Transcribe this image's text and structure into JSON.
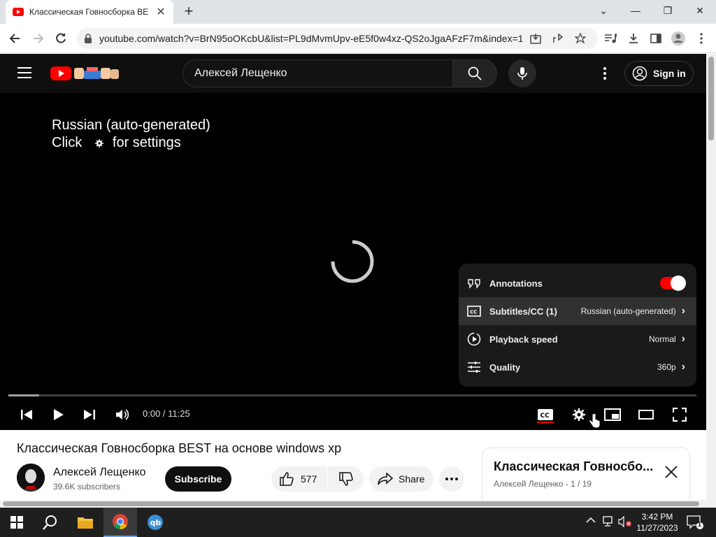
{
  "browser": {
    "tab_title": "Классическая Говносборка BEST",
    "url": "youtube.com/watch?v=BrN95oOKcbU&list=PL9dMvmUpv-eE5f0w4xz-QS2oJgaAFzF7m&index=1"
  },
  "youtube": {
    "search_value": "Алексей Лещенко",
    "sign_in_label": "Sign in"
  },
  "player": {
    "caption_line1": "Russian (auto-generated)",
    "caption_click": "Click",
    "caption_settings": "for settings",
    "time": "0:00 / 11:25",
    "settings_menu": [
      {
        "label": "Annotations",
        "value": "",
        "icon": "annotations-icon"
      },
      {
        "label": "Subtitles/CC (1)",
        "value": "Russian (auto-generated)",
        "icon": "subtitles-icon"
      },
      {
        "label": "Playback speed",
        "value": "Normal",
        "icon": "playback-speed-icon"
      },
      {
        "label": "Quality",
        "value": "360p",
        "icon": "quality-icon"
      }
    ],
    "annotations_on": true
  },
  "video": {
    "title": "Классическая Говносборка BEST на основе windows xp",
    "channel": "Алексей Лещенко",
    "subscribers": "39.6K subscribers",
    "subscribe_label": "Subscribe",
    "likes": "577",
    "share_label": "Share"
  },
  "playlist": {
    "title": "Классическая Говносбо...",
    "subtitle": "Алексей Лещенко - 1 / 19"
  },
  "taskbar": {
    "time": "3:42 PM",
    "date": "11/27/2023",
    "notifications": "1"
  },
  "colors": {
    "youtube_red": "#ff0000",
    "toggle_on": "#ff0000"
  }
}
